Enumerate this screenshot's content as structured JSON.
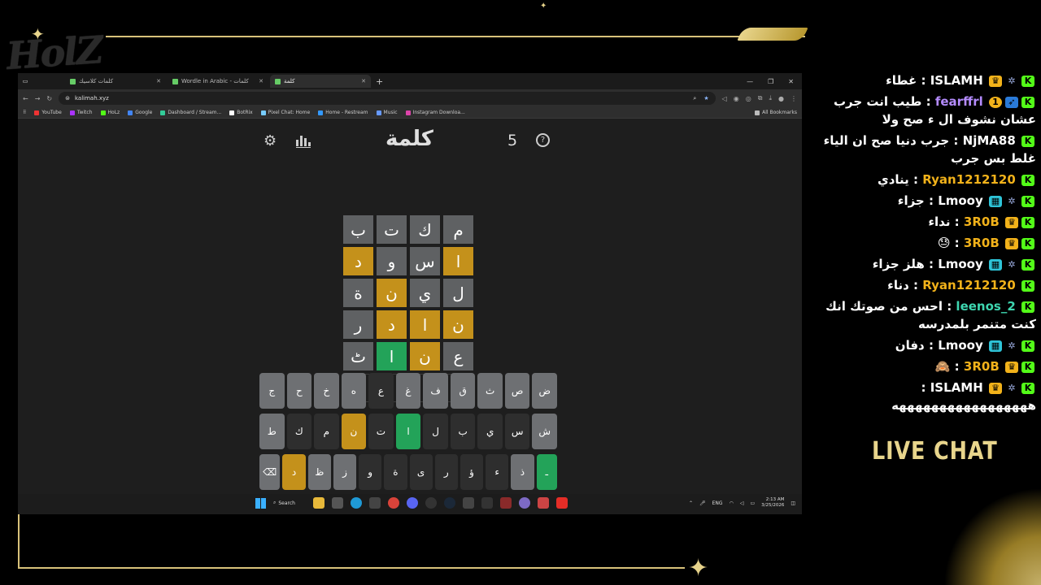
{
  "overlay": {
    "logo_text": "HolZ",
    "live_chat_label": "LIVE CHAT"
  },
  "browser": {
    "tabs": [
      {
        "title": "كلمات كلاسيك",
        "active": false
      },
      {
        "title": "Wordle in Arabic - كلمات",
        "active": false
      },
      {
        "title": "كلمة",
        "active": true
      }
    ],
    "url": "kalimah.xyz",
    "bookmarks": [
      "YouTube",
      "Twitch",
      "HoLz",
      "Google",
      "Dashboard / Stream...",
      "BotRix",
      "Pixel Chat: Home",
      "Home - Restream",
      "Music",
      "Instagram Downloa..."
    ],
    "all_bookmarks": "All Bookmarks"
  },
  "game": {
    "title": "كلمة",
    "score": "5",
    "board": [
      [
        {
          "l": "م",
          "s": "g"
        },
        {
          "l": "ك",
          "s": "g"
        },
        {
          "l": "ت",
          "s": "g"
        },
        {
          "l": "ب",
          "s": "g"
        }
      ],
      [
        {
          "l": "ا",
          "s": "y"
        },
        {
          "l": "س",
          "s": "g"
        },
        {
          "l": "و",
          "s": "g"
        },
        {
          "l": "د",
          "s": "y"
        }
      ],
      [
        {
          "l": "ل",
          "s": "g"
        },
        {
          "l": "ي",
          "s": "g"
        },
        {
          "l": "ن",
          "s": "y"
        },
        {
          "l": "ة",
          "s": "g"
        }
      ],
      [
        {
          "l": "ن",
          "s": "y"
        },
        {
          "l": "ا",
          "s": "y"
        },
        {
          "l": "د",
          "s": "y"
        },
        {
          "l": "ر",
          "s": "g"
        }
      ],
      [
        {
          "l": "ع",
          "s": "g"
        },
        {
          "l": "ن",
          "s": "y"
        },
        {
          "l": "ا",
          "s": "gr"
        },
        {
          "l": "ٹ",
          "s": "g"
        }
      ],
      [
        {
          "l": "",
          "s": "e"
        },
        {
          "l": "",
          "s": "e"
        },
        {
          "l": "",
          "s": "e"
        },
        {
          "l": "",
          "s": "e"
        }
      ]
    ],
    "keyboard": [
      [
        {
          "k": "ض",
          "s": "g"
        },
        {
          "k": "ص",
          "s": "g"
        },
        {
          "k": "ث",
          "s": "g"
        },
        {
          "k": "ق",
          "s": "g"
        },
        {
          "k": "ف",
          "s": "g"
        },
        {
          "k": "غ",
          "s": "g"
        },
        {
          "k": "ع",
          "s": "d"
        },
        {
          "k": "ه",
          "s": "g"
        },
        {
          "k": "خ",
          "s": "g"
        },
        {
          "k": "ح",
          "s": "g"
        },
        {
          "k": "ج",
          "s": "g"
        }
      ],
      [
        {
          "k": "ش",
          "s": "g"
        },
        {
          "k": "س",
          "s": "d"
        },
        {
          "k": "ي",
          "s": "d"
        },
        {
          "k": "ب",
          "s": "d"
        },
        {
          "k": "ل",
          "s": "d"
        },
        {
          "k": "ا",
          "s": "gr"
        },
        {
          "k": "ت",
          "s": "d"
        },
        {
          "k": "ن",
          "s": "y"
        },
        {
          "k": "م",
          "s": "d"
        },
        {
          "k": "ك",
          "s": "d"
        },
        {
          "k": "ط",
          "s": "g"
        }
      ],
      [
        {
          "k": "ـ",
          "s": "gr"
        },
        {
          "k": "ذ",
          "s": "g"
        },
        {
          "k": "ء",
          "s": "d"
        },
        {
          "k": "ؤ",
          "s": "d"
        },
        {
          "k": "ر",
          "s": "d"
        },
        {
          "k": "ى",
          "s": "d"
        },
        {
          "k": "ة",
          "s": "d"
        },
        {
          "k": "و",
          "s": "d"
        },
        {
          "k": "ز",
          "s": "g"
        },
        {
          "k": "ظ",
          "s": "g"
        },
        {
          "k": "د",
          "s": "y"
        },
        {
          "k": "⌫",
          "s": "g"
        }
      ]
    ]
  },
  "taskbar": {
    "search_label": "Search",
    "lang": "ENG",
    "time": "2:13 AM",
    "date": "3/25/2026"
  },
  "chat": [
    {
      "user": "ISLAMH",
      "color": "#ffffff",
      "badges": [
        "k",
        "star",
        "crown"
      ],
      "text": "غطاء"
    },
    {
      "user": "fearffrl",
      "color": "#b58cff",
      "badges": [
        "k",
        "fish",
        "one"
      ],
      "text": "طيب انت جرب عشان نشوف ال ء صح ولا"
    },
    {
      "user": "NjMA88",
      "color": "#ffffff",
      "badges": [
        "k"
      ],
      "text": "جرب دنيا صح ان الياء غلط بس جرب"
    },
    {
      "user": "Ryan1212120",
      "color": "#f2b21a",
      "badges": [
        "k"
      ],
      "text": "ينادي"
    },
    {
      "user": "Lmooy",
      "color": "#ffffff",
      "badges": [
        "k",
        "star",
        "sub"
      ],
      "text": "جزاء"
    },
    {
      "user": "3R0B",
      "color": "#f2b21a",
      "badges": [
        "k",
        "crown"
      ],
      "text": "نداء"
    },
    {
      "user": "3R0B",
      "color": "#f2b21a",
      "badges": [
        "k",
        "crown"
      ],
      "text": "😓"
    },
    {
      "user": "Lmooy",
      "color": "#ffffff",
      "badges": [
        "k",
        "star",
        "sub"
      ],
      "text": "هلز جزاء"
    },
    {
      "user": "Ryan1212120",
      "color": "#f2b21a",
      "badges": [
        "k"
      ],
      "text": "دناء"
    },
    {
      "user": "leenos_2",
      "color": "#3ed6b0",
      "badges": [
        "k"
      ],
      "text": "احس من صوتك انك كنت متنمر بلمدرسه"
    },
    {
      "user": "Lmooy",
      "color": "#ffffff",
      "badges": [
        "k",
        "star",
        "sub"
      ],
      "text": "دفان"
    },
    {
      "user": "3R0B",
      "color": "#f2b21a",
      "badges": [
        "k",
        "crown"
      ],
      "text": "🙈"
    },
    {
      "user": "ISLAMH",
      "color": "#ffffff",
      "badges": [
        "k",
        "star",
        "crown"
      ],
      "text": "هههههههههههههههههه"
    }
  ]
}
